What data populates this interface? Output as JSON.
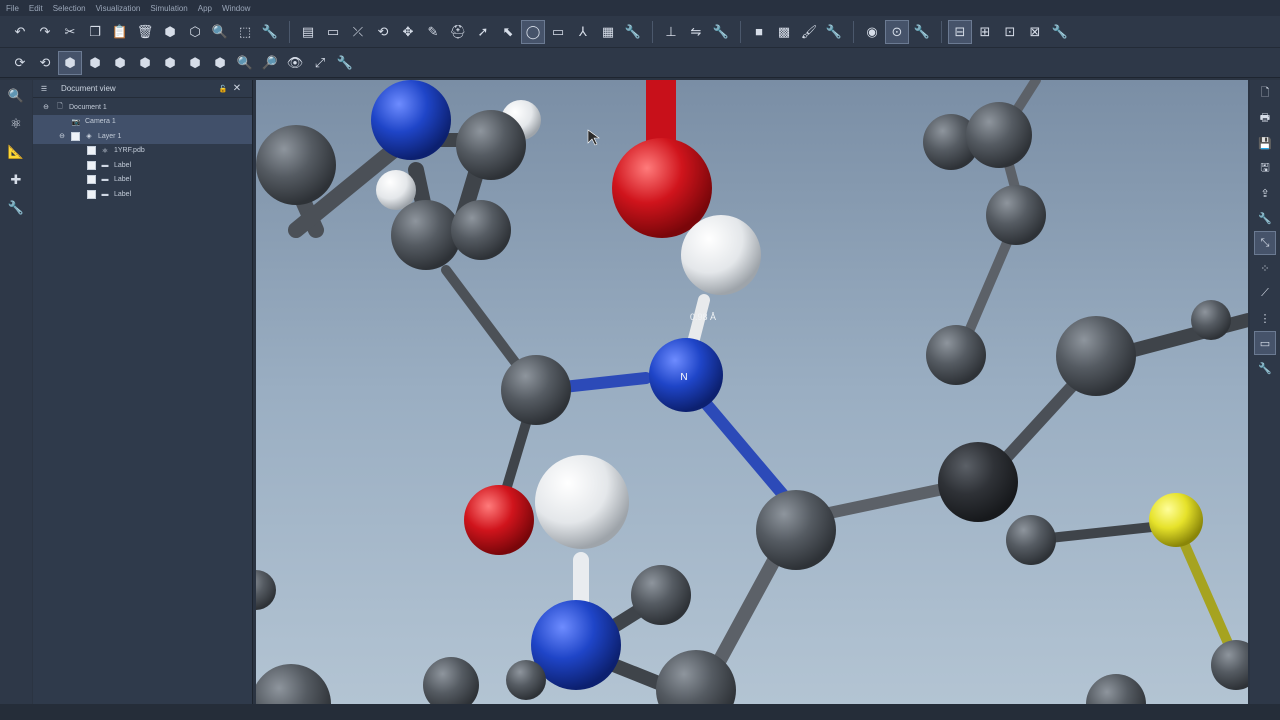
{
  "menu": [
    "File",
    "Edit",
    "Selection",
    "Visualization",
    "Simulation",
    "App",
    "Window"
  ],
  "toolbar_row1": [
    {
      "name": "undo-icon",
      "glyph": "↶"
    },
    {
      "name": "redo-icon",
      "glyph": "↷"
    },
    {
      "name": "cut-icon",
      "glyph": "✂"
    },
    {
      "name": "copy-icon",
      "glyph": "❐"
    },
    {
      "name": "paste-icon",
      "glyph": "📋"
    },
    {
      "name": "delete-icon",
      "glyph": "🗑"
    },
    {
      "name": "hide-icon",
      "glyph": "⬢"
    },
    {
      "name": "show-icon",
      "glyph": "⬡"
    },
    {
      "name": "zoom-icon",
      "glyph": "🔍"
    },
    {
      "name": "fit-icon",
      "glyph": "⬚"
    },
    {
      "name": "settings-wrench-icon",
      "glyph": "🔧"
    },
    {
      "name": "render-mode-icon",
      "glyph": "▤"
    },
    {
      "name": "background-icon",
      "glyph": "▭"
    },
    {
      "name": "bond-icon",
      "glyph": "⤫"
    },
    {
      "name": "rotate-icon",
      "glyph": "⟲"
    },
    {
      "name": "translate-icon",
      "glyph": "✥"
    },
    {
      "name": "pencil-icon",
      "glyph": "✎"
    },
    {
      "name": "hat-icon",
      "glyph": "⛑"
    },
    {
      "name": "pointer-icon",
      "glyph": "➚"
    },
    {
      "name": "select-icon",
      "glyph": "⬉"
    },
    {
      "name": "lasso-icon",
      "glyph": "◯"
    },
    {
      "name": "rectangle-select-icon",
      "glyph": "▭"
    },
    {
      "name": "angle-icon",
      "glyph": "⅄"
    },
    {
      "name": "mesh-icon",
      "glyph": "▦"
    },
    {
      "name": "settings-wrench-icon",
      "glyph": "🔧"
    },
    {
      "name": "axes-icon",
      "glyph": "⊥"
    },
    {
      "name": "flip-icon",
      "glyph": "⇋"
    },
    {
      "name": "settings-wrench-icon",
      "glyph": "🔧"
    },
    {
      "name": "solid-color-icon",
      "glyph": "■"
    },
    {
      "name": "gradient-icon",
      "glyph": "▩"
    },
    {
      "name": "paint-icon",
      "glyph": "🖌"
    },
    {
      "name": "settings-wrench-icon",
      "glyph": "🔧"
    },
    {
      "name": "light-icon",
      "glyph": "◉"
    },
    {
      "name": "record-icon",
      "glyph": "⊙"
    },
    {
      "name": "settings-wrench-icon",
      "glyph": "🔧"
    },
    {
      "name": "network-1-icon",
      "glyph": "⊟"
    },
    {
      "name": "network-2-icon",
      "glyph": "⊞"
    },
    {
      "name": "network-3-icon",
      "glyph": "⊡"
    },
    {
      "name": "network-4-icon",
      "glyph": "⊠"
    },
    {
      "name": "settings-wrench-icon",
      "glyph": "🔧"
    }
  ],
  "toolbar_row2": [
    {
      "name": "rotate-x-icon",
      "glyph": "⟳"
    },
    {
      "name": "rotate-y-icon",
      "glyph": "⟲"
    },
    {
      "name": "cube-front-icon",
      "glyph": "⬢"
    },
    {
      "name": "cube-back-icon",
      "glyph": "⬢"
    },
    {
      "name": "cube-left-icon",
      "glyph": "⬢"
    },
    {
      "name": "cube-right-icon",
      "glyph": "⬢"
    },
    {
      "name": "cube-top-icon",
      "glyph": "⬢"
    },
    {
      "name": "cube-bottom-icon",
      "glyph": "⬢"
    },
    {
      "name": "cube-iso-icon",
      "glyph": "⬢"
    },
    {
      "name": "zoom-in-icon",
      "glyph": "🔍"
    },
    {
      "name": "zoom-out-icon",
      "glyph": "🔎"
    },
    {
      "name": "eye-icon",
      "glyph": "👁"
    },
    {
      "name": "fit-all-icon",
      "glyph": "⤢"
    },
    {
      "name": "settings-wrench-icon",
      "glyph": "🔧"
    }
  ],
  "left_tools": [
    "magnify-icon",
    "atom-search-icon",
    "measure-icon",
    "add-atom-icon",
    "settings-wrench-icon"
  ],
  "right_tools": [
    "new-doc-icon",
    "print-icon",
    "save-icon",
    "save-as-icon",
    "export-icon",
    "settings-wrench-icon",
    "select-tool-icon",
    "node-icon",
    "path-icon",
    "graph-icon",
    "display-icon",
    "settings-wrench-icon"
  ],
  "document_view": {
    "title": "Document view",
    "tree": [
      {
        "label": "Document 1",
        "indent": 0,
        "icon": "document-icon",
        "checkbox": false,
        "selected": false
      },
      {
        "label": "Camera 1",
        "indent": 1,
        "icon": "camera-icon",
        "checkbox": false,
        "selected": true
      },
      {
        "label": "Layer 1",
        "indent": 1,
        "icon": "layer-icon",
        "checkbox": true,
        "selected": true
      },
      {
        "label": "1YRF.pdb",
        "indent": 2,
        "icon": "molecule-icon",
        "checkbox": true,
        "selected": false
      },
      {
        "label": "Label",
        "indent": 2,
        "icon": "label-icon",
        "checkbox": true,
        "selected": false
      },
      {
        "label": "Label",
        "indent": 2,
        "icon": "label-icon",
        "checkbox": true,
        "selected": false
      },
      {
        "label": "Label",
        "indent": 2,
        "icon": "label-icon",
        "checkbox": true,
        "selected": false
      }
    ]
  },
  "viewport": {
    "atom_label": "N",
    "distance_label": "0.98 Å",
    "colors": {
      "carbon": "#555a60",
      "nitrogen": "#1f45c8",
      "oxygen": "#d0141c",
      "hydrogen": "#e9ecef",
      "sulfur": "#e0dc2a",
      "background_top": "#7a8ea5",
      "background_bottom": "#b3c4d3"
    }
  }
}
